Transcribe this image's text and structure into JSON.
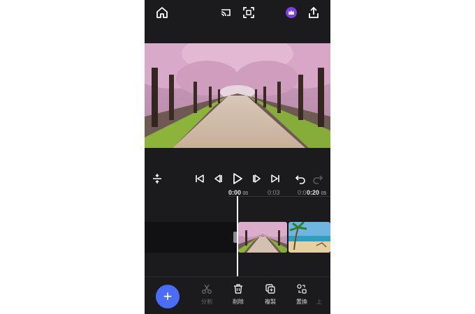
{
  "topbar": {
    "icons": [
      "home-icon",
      "cast-icon",
      "fullscreen-icon",
      "premium-crown-icon",
      "share-icon"
    ]
  },
  "controls": {
    "icons": [
      "split-view-icon",
      "skip-start-icon",
      "prev-frame-icon",
      "play-icon",
      "next-frame-icon",
      "skip-end-icon",
      "undo-icon",
      "redo-icon"
    ]
  },
  "timeline": {
    "current_time": "0:00",
    "current_frames": "00",
    "marker_2": "0:03",
    "marker_3": "0:0",
    "total_time": "0:20",
    "total_frames": "05",
    "clips": [
      "cherry-blossom-clip",
      "beach-clip"
    ]
  },
  "bottom_toolbar": {
    "add_label": "+",
    "tools": [
      {
        "label": "分割",
        "icon": "scissors-icon",
        "enabled": false
      },
      {
        "label": "削除",
        "icon": "trash-icon",
        "enabled": true
      },
      {
        "label": "複製",
        "icon": "duplicate-icon",
        "enabled": true
      },
      {
        "label": "置換",
        "icon": "replace-icon",
        "enabled": true
      },
      {
        "label": "上",
        "icon": "overflow-icon",
        "enabled": false
      }
    ]
  },
  "colors": {
    "background": "#1b1b1d",
    "accent": "#4b6cf7",
    "crown": "#7b3fe4"
  }
}
